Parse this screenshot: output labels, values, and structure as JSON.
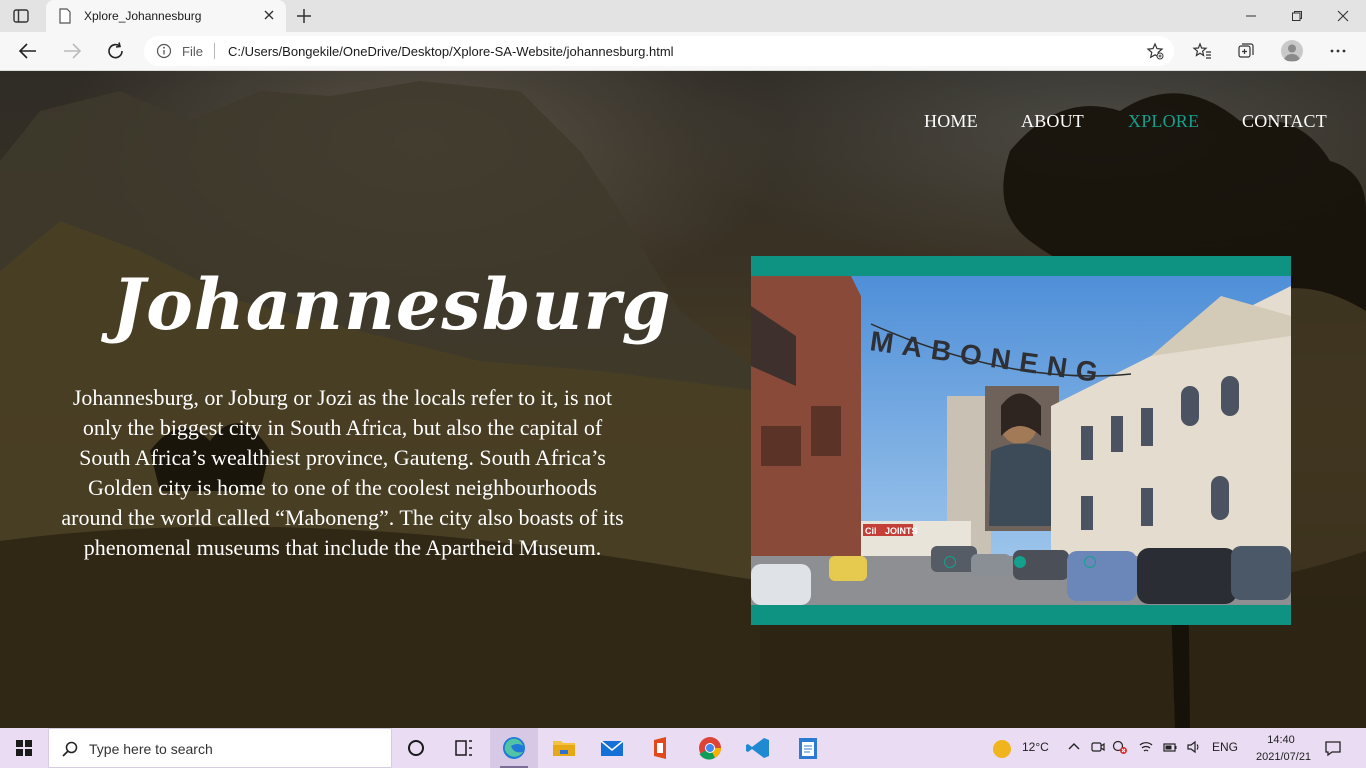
{
  "browser": {
    "tab_title": "Xplore_Johannesburg",
    "address_scheme": "File",
    "url": "C:/Users/Bongekile/OneDrive/Desktop/Xplore-SA-Website/johannesburg.html"
  },
  "nav": {
    "items": [
      {
        "label": "HOME"
      },
      {
        "label": "ABOUT"
      },
      {
        "label": "XPLORE",
        "active": true
      },
      {
        "label": "CONTACT"
      }
    ]
  },
  "hero": {
    "title": "Johannesburg",
    "paragraph": "Johannesburg, or Joburg or Jozi as the locals refer to it, is not only the biggest city in South Africa, but also the capital of South Africa’s wealthiest province, Gauteng. South Africa’s Golden city is home to one of the coolest neighbourhoods around the world called “Maboneng”. The city also boasts of its phenomenal museums that include the Apartheid Museum."
  },
  "slideshow": {
    "image_sign": "MABONENG",
    "shop_sign": "JOINTS",
    "shop_sign_prefix": "Cil",
    "dots": [
      false,
      true,
      false
    ]
  },
  "taskbar": {
    "search_placeholder": "Type here to search",
    "weather": "12°C",
    "language": "ENG",
    "time": "14:40",
    "date": "2021/07/21"
  },
  "colors": {
    "accent": "#0e9282",
    "nav_active": "#14a08c",
    "taskbar": "#eadcf2"
  }
}
